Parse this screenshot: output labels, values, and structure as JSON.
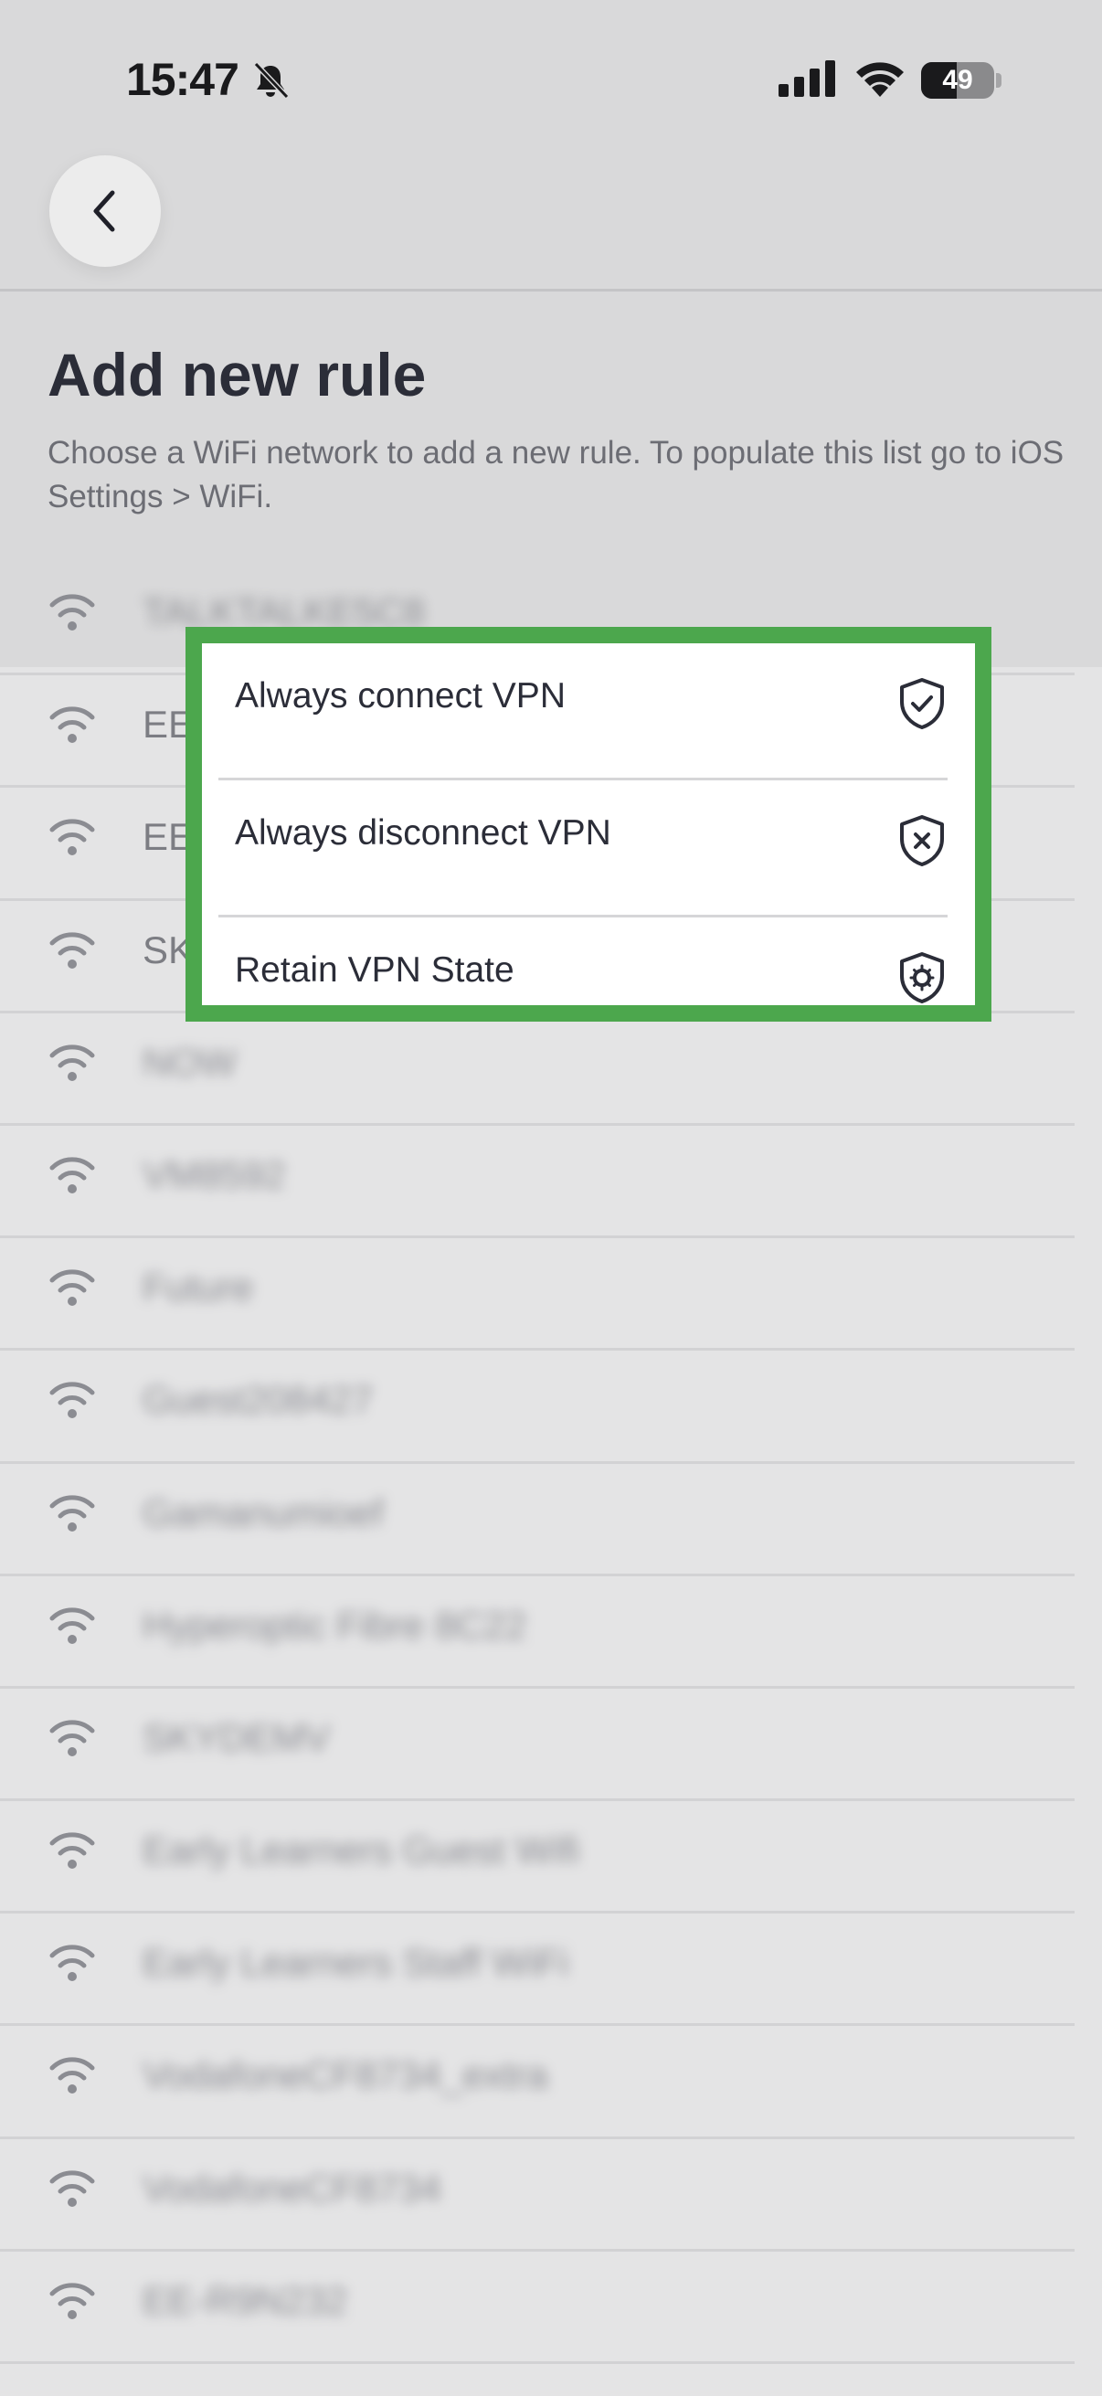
{
  "status_bar": {
    "time": "15:47",
    "battery_level": "49",
    "battery_fraction": 0.49
  },
  "header": {
    "back_icon": "chevron-left-icon",
    "title": "Add new rule",
    "subtitle": "Choose a WiFi network to add a new rule. To populate this list go to iOS Settings > WiFi."
  },
  "networks": [
    {
      "ssid": "TALKTALKE5C8"
    },
    {
      "ssid": "EE"
    },
    {
      "ssid": "EE"
    },
    {
      "ssid": "SK"
    },
    {
      "ssid": "NOW"
    },
    {
      "ssid": "VM8592"
    },
    {
      "ssid": "Future"
    },
    {
      "ssid": "Guest208427"
    },
    {
      "ssid": "Gamanumioef"
    },
    {
      "ssid": "Hyperoptic Fibre 8C22"
    },
    {
      "ssid": "SKYDEMV"
    },
    {
      "ssid": "Early Learners Guest Wifi"
    },
    {
      "ssid": "Early Learners Staff WiFi"
    },
    {
      "ssid": "VodafoneCF8734_extra"
    },
    {
      "ssid": "VodafoneCF8734"
    },
    {
      "ssid": "EE-R9N232"
    }
  ],
  "menu": {
    "items": [
      {
        "label": "Always connect VPN",
        "icon": "shield-check-icon"
      },
      {
        "label": "Always disconnect VPN",
        "icon": "shield-x-icon"
      },
      {
        "label": "Retain VPN State",
        "icon": "shield-gear-icon"
      }
    ],
    "highlight_color": "#4ca74d"
  }
}
